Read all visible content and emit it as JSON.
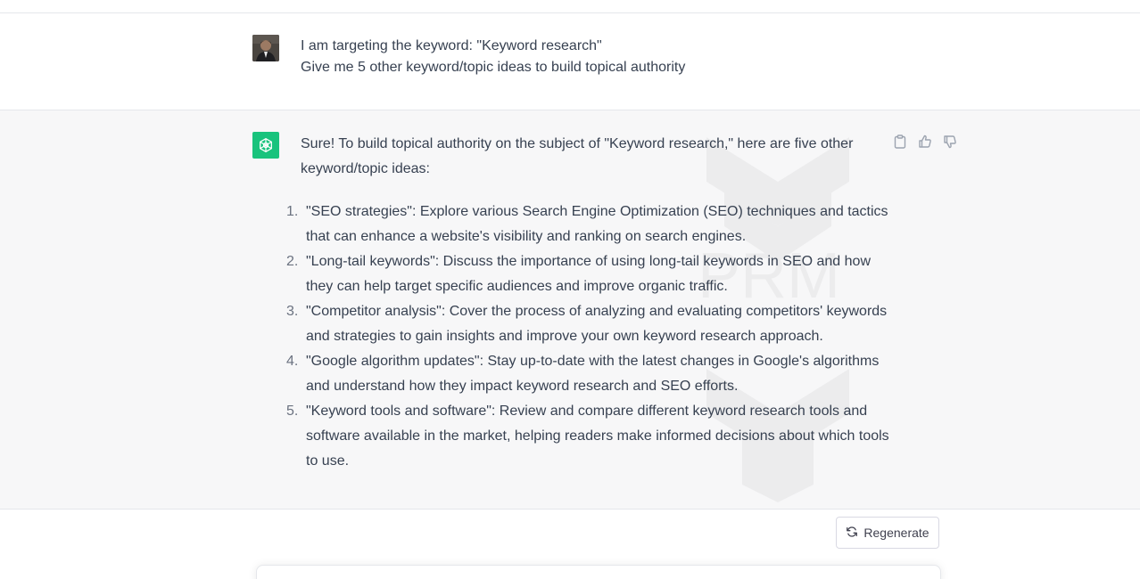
{
  "user_message": {
    "lines": [
      "I am targeting the keyword: \"Keyword research\"",
      "Give me 5 other keyword/topic ideas to build topical authority"
    ]
  },
  "assistant_message": {
    "intro": "Sure! To build topical authority on the subject of \"Keyword research,\" here are five other keyword/topic ideas:",
    "items": [
      {
        "number": "1.",
        "text": "\"SEO strategies\": Explore various Search Engine Optimization (SEO) techniques and tactics that can enhance a website's visibility and ranking on search engines."
      },
      {
        "number": "2.",
        "text": "\"Long-tail keywords\": Discuss the importance of using long-tail keywords in SEO and how they can help target specific audiences and improve organic traffic."
      },
      {
        "number": "3.",
        "text": "\"Competitor analysis\": Cover the process of analyzing and evaluating competitors' keywords and strategies to gain insights and improve your own keyword research approach."
      },
      {
        "number": "4.",
        "text": "\"Google algorithm updates\": Stay up-to-date with the latest changes in Google's algorithms and understand how they impact keyword research and SEO efforts."
      },
      {
        "number": "5.",
        "text": "\"Keyword tools and software\": Review and compare different keyword research tools and software available in the market, helping readers make informed decisions about which tools to use."
      }
    ],
    "action_icons": [
      "clipboard-icon",
      "thumbs-up-icon",
      "thumbs-down-icon"
    ]
  },
  "controls": {
    "regenerate_label": "Regenerate",
    "regenerate_icon": "refresh-icon"
  },
  "colors": {
    "assistant_avatar": "#19c37d",
    "assistant_bg": "#f7f7f8",
    "text": "#374151"
  }
}
